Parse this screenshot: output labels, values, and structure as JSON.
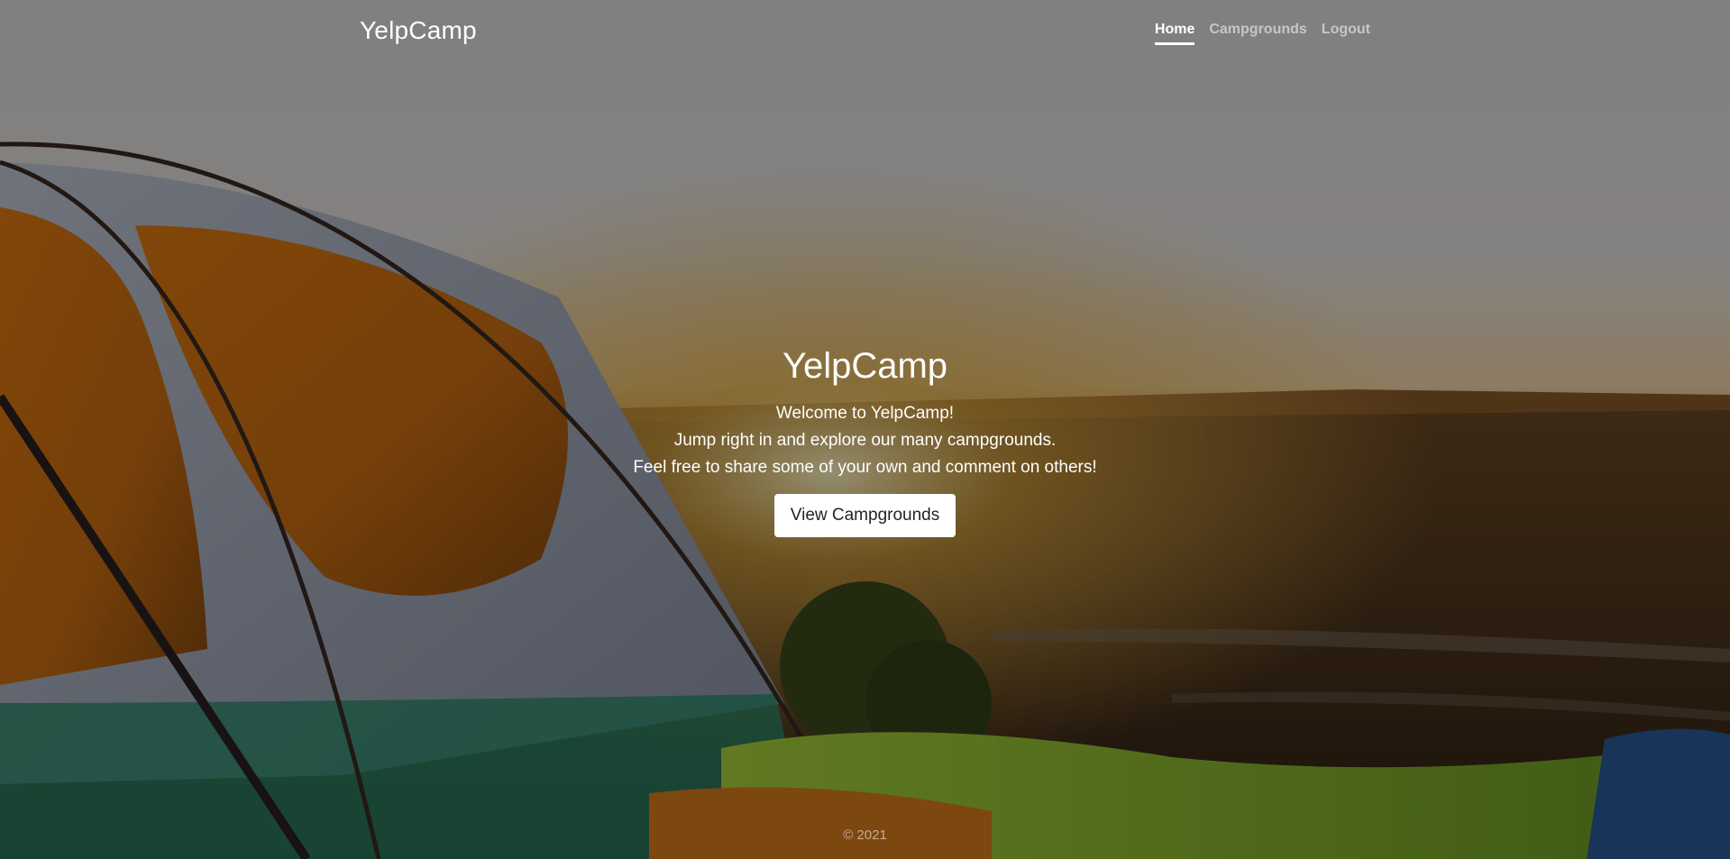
{
  "navbar": {
    "brand": "YelpCamp",
    "links": [
      {
        "label": "Home",
        "active": true
      },
      {
        "label": "Campgrounds",
        "active": false
      },
      {
        "label": "Logout",
        "active": false
      }
    ]
  },
  "hero": {
    "title": "YelpCamp",
    "lines": [
      "Welcome to YelpCamp!",
      "Jump right in and explore our many campgrounds.",
      "Feel free to share some of your own and comment on others!"
    ],
    "button_label": "View Campgrounds"
  },
  "footer": {
    "text": "© 2021"
  },
  "colors": {
    "overlay": "#000000",
    "text": "#ffffff",
    "button_bg": "#ffffff",
    "button_text": "#212529"
  }
}
